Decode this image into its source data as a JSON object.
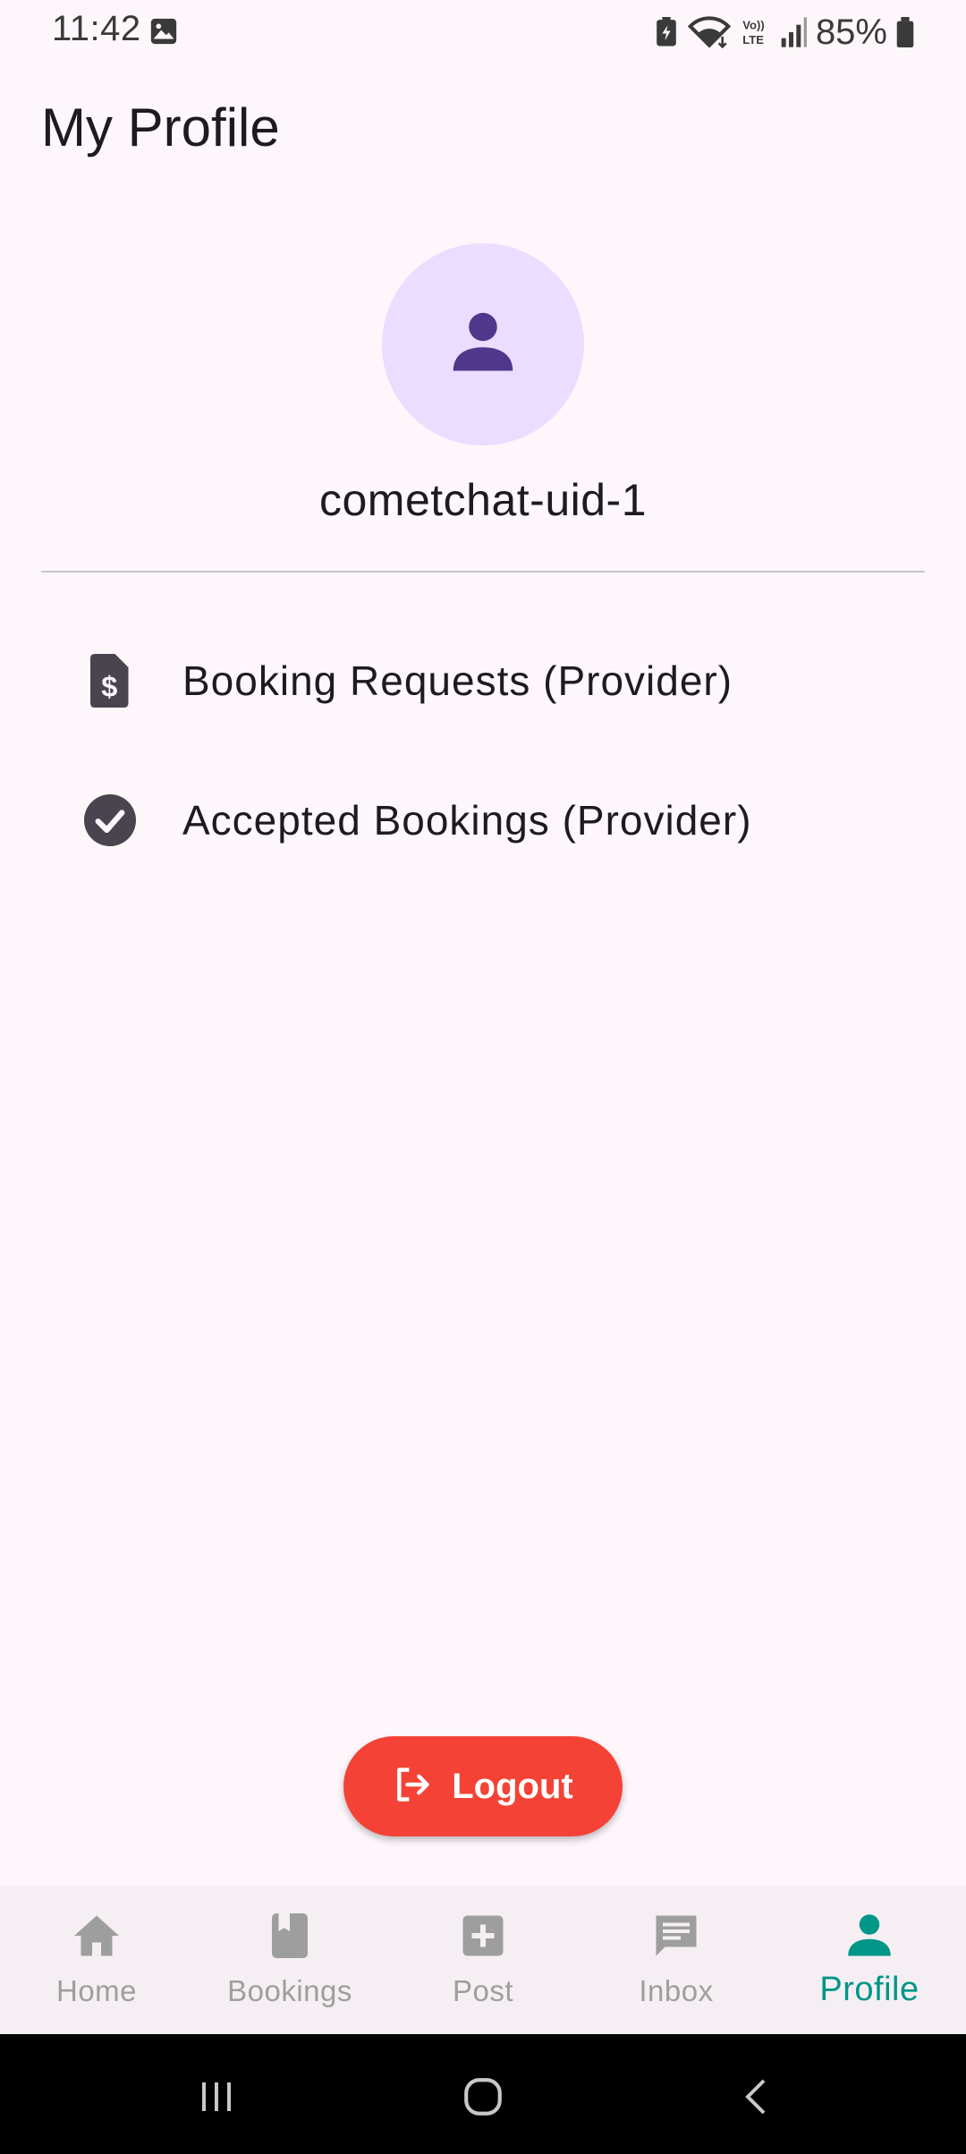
{
  "status_bar": {
    "time": "11:42",
    "battery_percent": "85%",
    "left_icons": [
      "gallery-notification-icon"
    ],
    "right_icons": [
      "battery-saver-icon",
      "wifi-icon",
      "volte-icon",
      "signal-icon",
      "battery-icon"
    ]
  },
  "page": {
    "title": "My Profile"
  },
  "profile": {
    "username": "cometchat-uid-1",
    "avatar_icon": "person-icon",
    "avatar_bg": "#eaddff",
    "avatar_fg": "#4f378b"
  },
  "menu": {
    "items": [
      {
        "label": "Booking Requests (Provider)",
        "icon": "request-quote-icon"
      },
      {
        "label": "Accepted Bookings (Provider)",
        "icon": "check-circle-icon"
      }
    ]
  },
  "logout": {
    "label": "Logout",
    "icon": "logout-icon",
    "color": "#f44336"
  },
  "bottom_nav": {
    "active_color": "#009688",
    "inactive_color": "#9e9e9e",
    "items": [
      {
        "label": "Home",
        "icon": "home-icon",
        "active": false
      },
      {
        "label": "Bookings",
        "icon": "book-icon",
        "active": false
      },
      {
        "label": "Post",
        "icon": "add-box-icon",
        "active": false
      },
      {
        "label": "Inbox",
        "icon": "chat-icon",
        "active": false
      },
      {
        "label": "Profile",
        "icon": "person-icon",
        "active": true
      }
    ]
  },
  "system_nav": {
    "buttons": [
      "recents-icon",
      "home-circle-icon",
      "back-icon"
    ]
  }
}
